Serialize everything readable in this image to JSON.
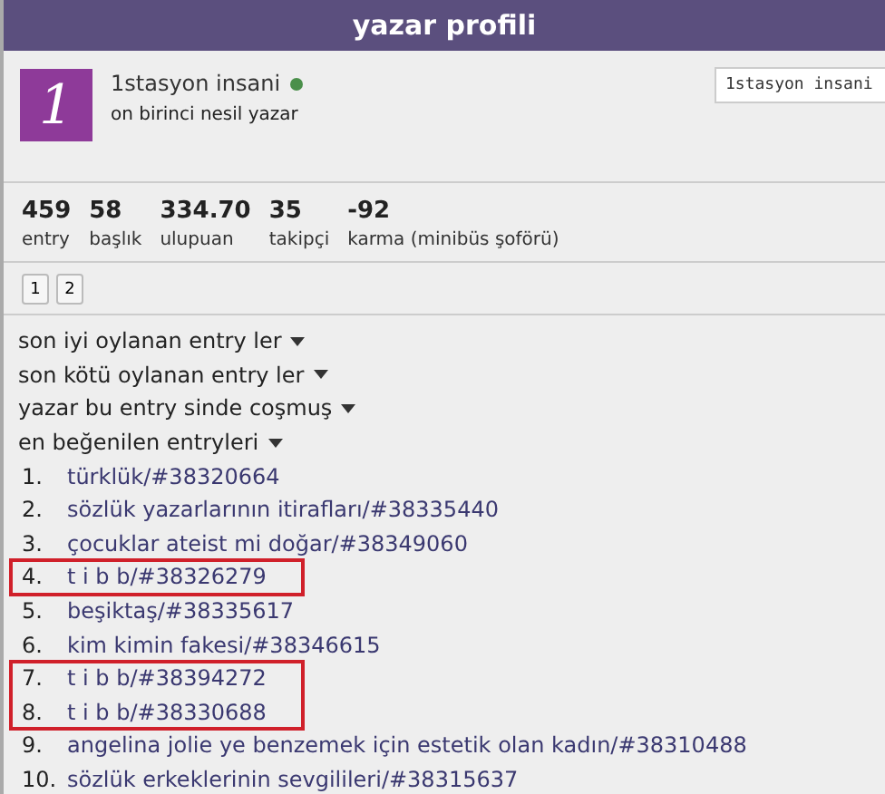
{
  "header": {
    "title": "yazar profili"
  },
  "profile": {
    "avatar_letter": "1",
    "name": "1stasyon insani",
    "online": true,
    "subtitle": "on birinci nesil yazar",
    "search": {
      "value": "1stasyon insani"
    }
  },
  "stats": [
    {
      "value": "459",
      "label": "entry"
    },
    {
      "value": "58",
      "label": "başlık"
    },
    {
      "value": "334.70",
      "label": "ulupuan"
    },
    {
      "value": "35",
      "label": "takipçi"
    },
    {
      "value": "-92",
      "label": "karma (minibüs şoförü)"
    }
  ],
  "pages": [
    "1",
    "2"
  ],
  "menus": [
    "son iyi oylanan entry ler",
    "son kötü oylanan entry ler",
    "yazar bu entry sinde coşmuş",
    "en beğenilen entryleri"
  ],
  "entry_groups": [
    {
      "highlighted": false,
      "items": [
        {
          "number": "1.",
          "text": "türklük/#38320664"
        },
        {
          "number": "2.",
          "text": "sözlük yazarlarının itirafları/#38335440"
        },
        {
          "number": "3.",
          "text": "çocuklar ateist mi doğar/#38349060"
        }
      ]
    },
    {
      "highlighted": true,
      "items": [
        {
          "number": "4.",
          "text": "t i b b/#38326279"
        }
      ]
    },
    {
      "highlighted": false,
      "items": [
        {
          "number": "5.",
          "text": "beşiktaş/#38335617"
        },
        {
          "number": "6.",
          "text": "kim kimin fakesi/#38346615"
        }
      ]
    },
    {
      "highlighted": true,
      "items": [
        {
          "number": "7.",
          "text": "t i b b/#38394272"
        },
        {
          "number": "8.",
          "text": "t i b b/#38330688"
        }
      ]
    },
    {
      "highlighted": false,
      "items": [
        {
          "number": "9.",
          "text": "angelina jolie ye benzemek için estetik olan kadın/#38310488"
        },
        {
          "number": "10.",
          "text": "sözlük erkeklerinin sevgilileri/#38315637"
        }
      ]
    }
  ]
}
